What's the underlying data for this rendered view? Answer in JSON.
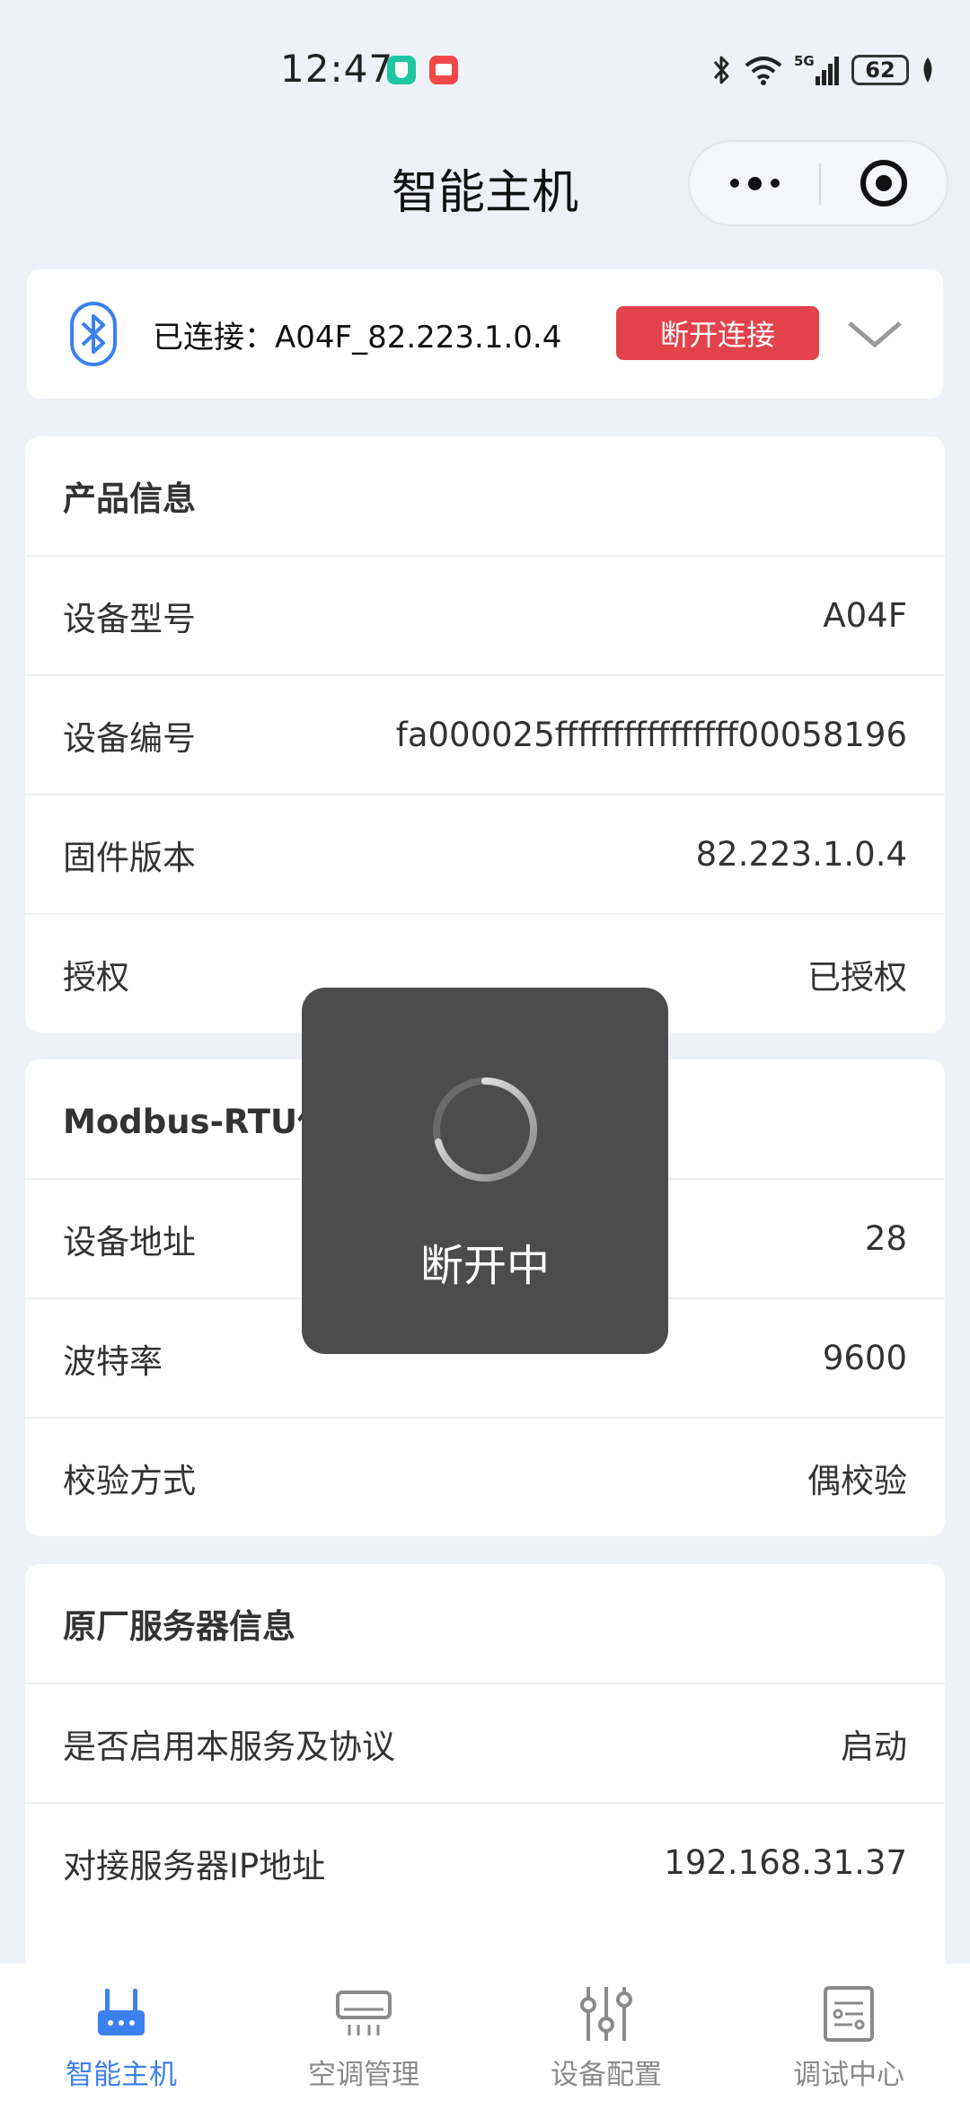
{
  "status_bar": {
    "time": "12:47",
    "battery": "62",
    "network": "5G"
  },
  "header": {
    "title": "智能主机"
  },
  "connection": {
    "status_text": "已连接：A04F_82.223.1.0.4",
    "disconnect_label": "断开连接"
  },
  "product_info": {
    "title": "产品信息",
    "rows": [
      {
        "label": "设备型号",
        "value": "A04F"
      },
      {
        "label": "设备编号",
        "value": "fa000025ffffffffffffffff00058196"
      },
      {
        "label": "固件版本",
        "value": "82.223.1.0.4"
      },
      {
        "label": "授权",
        "value": "已授权"
      }
    ]
  },
  "modbus_info": {
    "title": "Modbus-RTU信息",
    "rows": [
      {
        "label": "设备地址",
        "value": "28"
      },
      {
        "label": "波特率",
        "value": "9600"
      },
      {
        "label": "校验方式",
        "value": "偶校验"
      }
    ]
  },
  "server_info": {
    "title": "原厂服务器信息",
    "rows": [
      {
        "label": "是否启用本服务及协议",
        "value": "启动"
      },
      {
        "label": "对接服务器IP地址",
        "value": "192.168.31.37"
      }
    ]
  },
  "toast": {
    "text": "断开中"
  },
  "tab_bar": {
    "tabs": [
      {
        "label": "智能主机",
        "icon": "router-icon",
        "active": true
      },
      {
        "label": "空调管理",
        "icon": "air-conditioner-icon",
        "active": false
      },
      {
        "label": "设备配置",
        "icon": "sliders-icon",
        "active": false
      },
      {
        "label": "调试中心",
        "icon": "checklist-icon",
        "active": false
      }
    ]
  },
  "colors": {
    "accent": "#3b80ef",
    "danger": "#e2434a",
    "background": "#eff1f8"
  }
}
